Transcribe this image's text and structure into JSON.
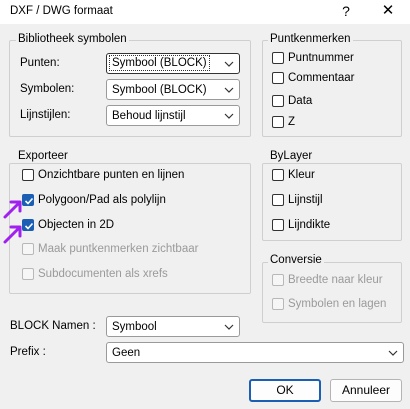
{
  "window": {
    "title": "DXF / DWG formaat",
    "help": "?",
    "close": "✕"
  },
  "library": {
    "legend": "Bibliotheek symbolen",
    "points_label": "Punten:",
    "points_value": "Symbool (BLOCK)",
    "symbols_label": "Symbolen:",
    "symbols_value": "Symbool (BLOCK)",
    "lines_label": "Lijnstijlen:",
    "lines_value": "Behoud lijnstijl"
  },
  "point_labels": {
    "legend": "Puntkenmerken",
    "items": [
      {
        "label": "Puntnummer",
        "checked": false
      },
      {
        "label": "Commentaar",
        "checked": false
      },
      {
        "label": "Data",
        "checked": false
      },
      {
        "label": "Z",
        "checked": false
      }
    ]
  },
  "export": {
    "legend": "Exporteer",
    "items": [
      {
        "label": "Onzichtbare punten en lijnen",
        "checked": false,
        "disabled": false
      },
      {
        "label": "Polygoon/Pad als polylijn",
        "checked": true,
        "disabled": false
      },
      {
        "label": "Objecten in 2D",
        "checked": true,
        "disabled": false
      },
      {
        "label": "Maak puntkenmerken zichtbaar",
        "checked": false,
        "disabled": true
      },
      {
        "label": "Subdocumenten als xrefs",
        "checked": false,
        "disabled": true
      }
    ]
  },
  "bylayer": {
    "legend": "ByLayer",
    "items": [
      {
        "label": "Kleur",
        "checked": false
      },
      {
        "label": "Lijnstijl",
        "checked": false
      },
      {
        "label": "Lijndikte",
        "checked": false
      }
    ]
  },
  "conversion": {
    "legend": "Conversie",
    "items": [
      {
        "label": "Breedte naar kleur",
        "checked": false,
        "disabled": true
      },
      {
        "label": "Symbolen en lagen",
        "checked": false,
        "disabled": true
      }
    ]
  },
  "block_names": {
    "label": "BLOCK Namen :",
    "value": "Symbool"
  },
  "prefix": {
    "label": "Prefix :",
    "value": "Geen"
  },
  "buttons": {
    "ok": "OK",
    "cancel": "Annuleer"
  },
  "colors": {
    "accent": "#1a5fb4",
    "annotation_arrow": "#a020f0"
  }
}
